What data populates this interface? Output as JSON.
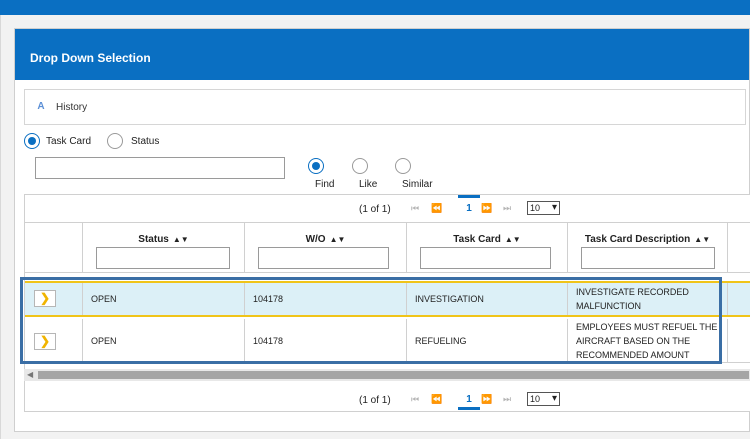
{
  "dialog": {
    "title": "Drop Down Selection"
  },
  "history": {
    "label": "History",
    "icon": "history-icon"
  },
  "search_mode": {
    "options": [
      {
        "label": "Task Card",
        "selected": true
      },
      {
        "label": "Status",
        "selected": false
      }
    ]
  },
  "search": {
    "value": "",
    "placeholder": ""
  },
  "match_mode": {
    "options": [
      {
        "label": "Find",
        "selected": true
      },
      {
        "label": "Like",
        "selected": false
      },
      {
        "label": "Similar",
        "selected": false
      }
    ]
  },
  "pager": {
    "count": "(1 of 1)",
    "current_page": "1",
    "page_size": "10"
  },
  "table": {
    "columns": [
      "Status",
      "W/O",
      "Task Card",
      "Task Card Description"
    ],
    "rows": [
      {
        "status": "OPEN",
        "wo": "104178",
        "task_card": "INVESTIGATION",
        "description": "INVESTIGATE RECORDED MALFUNCTION"
      },
      {
        "status": "OPEN",
        "wo": "104178",
        "task_card": "REFUELING",
        "description": "EMPLOYEES MUST REFUEL THE AIRCRAFT BASED ON THE RECOMMENDED AMOUNT"
      }
    ]
  },
  "colors": {
    "header_blue": "#0a6fc2",
    "highlight_row": "#dcf0f7",
    "highlight_border": "#f0c419",
    "selection_box": "#3a6ea5"
  }
}
